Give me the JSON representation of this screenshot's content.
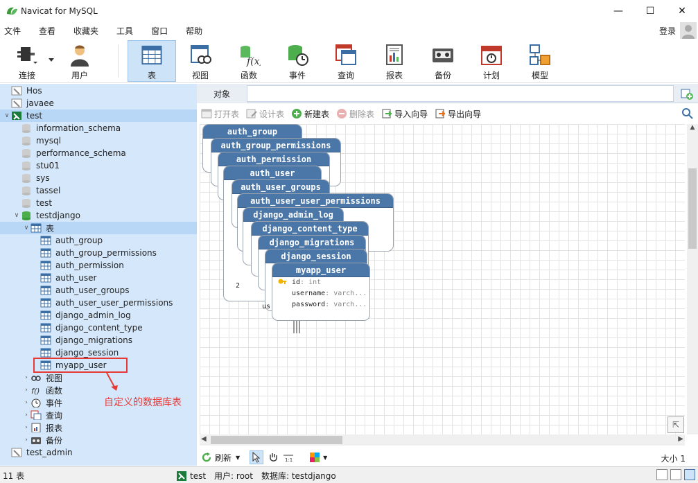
{
  "app": {
    "title": "Navicat for MySQL"
  },
  "menu": [
    "文件",
    "查看",
    "收藏夹",
    "工具",
    "窗口",
    "帮助"
  ],
  "login": "登录",
  "toolbar": [
    {
      "label": "连接",
      "icon": "plug-icon"
    },
    {
      "label": "用户",
      "icon": "user-icon"
    },
    {
      "label": "表",
      "icon": "table-icon",
      "active": true
    },
    {
      "label": "视图",
      "icon": "view-icon"
    },
    {
      "label": "函数",
      "icon": "function-icon"
    },
    {
      "label": "事件",
      "icon": "event-icon"
    },
    {
      "label": "查询",
      "icon": "query-icon"
    },
    {
      "label": "报表",
      "icon": "report-icon"
    },
    {
      "label": "备份",
      "icon": "backup-icon"
    },
    {
      "label": "计划",
      "icon": "schedule-icon"
    },
    {
      "label": "模型",
      "icon": "model-icon"
    }
  ],
  "sidebar": {
    "items": [
      {
        "label": "Hos",
        "type": "conn"
      },
      {
        "label": "javaee",
        "type": "conn"
      },
      {
        "label": "test",
        "type": "conn"
      },
      {
        "label": "information_schema",
        "type": "db"
      },
      {
        "label": "mysql",
        "type": "db"
      },
      {
        "label": "performance_schema",
        "type": "db"
      },
      {
        "label": "stu01",
        "type": "db"
      },
      {
        "label": "sys",
        "type": "db"
      },
      {
        "label": "tassel",
        "type": "db"
      },
      {
        "label": "test",
        "type": "db"
      },
      {
        "label": "testdjango",
        "type": "db-open"
      },
      {
        "label": "表",
        "type": "tables"
      },
      {
        "label": "auth_group",
        "type": "table"
      },
      {
        "label": "auth_group_permissions",
        "type": "table"
      },
      {
        "label": "auth_permission",
        "type": "table"
      },
      {
        "label": "auth_user",
        "type": "table"
      },
      {
        "label": "auth_user_groups",
        "type": "table"
      },
      {
        "label": "auth_user_user_permissions",
        "type": "table"
      },
      {
        "label": "django_admin_log",
        "type": "table"
      },
      {
        "label": "django_content_type",
        "type": "table"
      },
      {
        "label": "django_migrations",
        "type": "table"
      },
      {
        "label": "django_session",
        "type": "table"
      },
      {
        "label": "myapp_user",
        "type": "table"
      },
      {
        "label": "视图",
        "type": "views"
      },
      {
        "label": "函数",
        "type": "funcs"
      },
      {
        "label": "事件",
        "type": "events"
      },
      {
        "label": "查询",
        "type": "queries"
      },
      {
        "label": "报表",
        "type": "reports"
      },
      {
        "label": "备份",
        "type": "backups"
      },
      {
        "label": "test_admin",
        "type": "conn"
      }
    ]
  },
  "annotation": "自定义的数据库表",
  "objects_tab": "对象",
  "object_toolbar": [
    {
      "label": "打开表",
      "disabled": true
    },
    {
      "label": "设计表",
      "disabled": true
    },
    {
      "label": "新建表",
      "disabled": false
    },
    {
      "label": "删除表",
      "disabled": true
    },
    {
      "label": "导入向导",
      "disabled": false
    },
    {
      "label": "导出向导",
      "disabled": false
    }
  ],
  "er_tables": [
    "auth_group",
    "auth_group_permissions",
    "auth_permission",
    "auth_user",
    "auth_user_groups",
    "auth_user_user_permissions",
    "django_admin_log",
    "django_content_type",
    "django_migrations",
    "django_session",
    "myapp_user"
  ],
  "myapp_user_cols": [
    {
      "name": "id",
      "type": ": int"
    },
    {
      "name": "username",
      "type": ": varch..."
    },
    {
      "name": "password",
      "type": ": varch..."
    }
  ],
  "partial_text": {
    "a": "2",
    "b": "us"
  },
  "bottom": {
    "refresh": "刷新",
    "zoom": "大小 1"
  },
  "status": {
    "count": "11 表",
    "conn": "test",
    "user": "用户: root",
    "db": "数据库: testdjango"
  }
}
